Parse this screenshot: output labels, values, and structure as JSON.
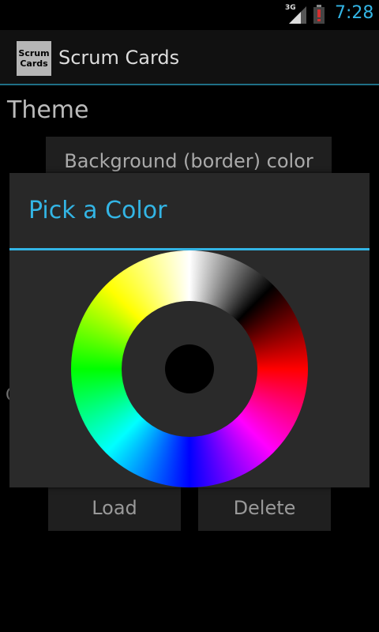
{
  "statusbar": {
    "network": "3G",
    "time": "7:28",
    "colors": {
      "time": "#33b5e5",
      "battery_alert": "#d32f2f"
    }
  },
  "actionbar": {
    "app_icon_text": "Scrum Cards",
    "title": "Scrum Cards"
  },
  "page": {
    "theme_heading": "Theme",
    "background_button": "Background (border) color",
    "left_stub": "C",
    "load_button": "Load",
    "delete_button": "Delete"
  },
  "dialog": {
    "title": "Pick a Color",
    "accent_color": "#33b5e5",
    "selected_color": "#000000",
    "wheel_colors": [
      "#ffffff",
      "#000000",
      "#ff0000",
      "#ff00ff",
      "#0000ff",
      "#00ffff",
      "#00ff00",
      "#ffff00"
    ]
  }
}
